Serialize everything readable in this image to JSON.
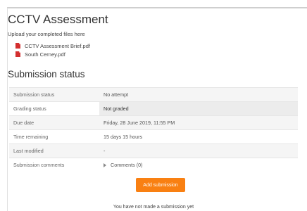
{
  "page": {
    "title": "CCTV Assessment",
    "intro": "Upload your completed files here"
  },
  "files": [
    {
      "name": "CCTV Assessment Brief.pdf",
      "icon": "pdf-icon"
    },
    {
      "name": "South Cerney.pdf",
      "icon": "pdf-icon"
    }
  ],
  "submission": {
    "heading": "Submission status",
    "rows": [
      {
        "label": "Submission status",
        "value": "No attempt"
      },
      {
        "label": "Grading status",
        "value": "Not graded"
      },
      {
        "label": "Due date",
        "value": "Friday, 28 June 2019, 11:55 PM"
      },
      {
        "label": "Time remaining",
        "value": "15 days 15 hours"
      },
      {
        "label": "Last modified",
        "value": "-"
      },
      {
        "label": "Submission comments",
        "value": "Comments (0)"
      }
    ]
  },
  "actions": {
    "add_submission_label": "Add submission",
    "note": "You have not made a submission yet"
  },
  "colors": {
    "accent": "#f98012",
    "pdf_icon": "#d32f2f"
  }
}
